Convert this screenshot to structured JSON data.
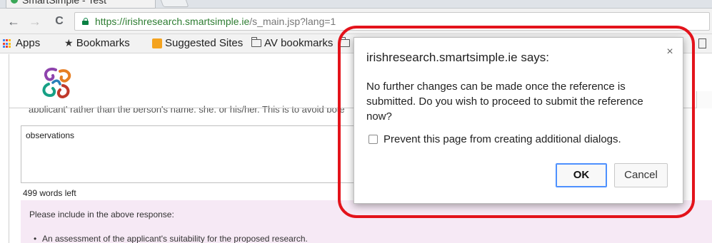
{
  "browser": {
    "tab_title": "SmartSimple - Test",
    "url_domain": "https://irishresearch.smartsimple.ie",
    "url_path": "/s_main.jsp?lang=1",
    "nav": {
      "back": "←",
      "forward": "→",
      "reload": "C"
    }
  },
  "bookmarks_bar": {
    "items": [
      {
        "label": "Apps",
        "icon": "apps-grid-icon"
      },
      {
        "label": "Bookmarks",
        "icon": "star-icon"
      },
      {
        "label": "Suggested Sites",
        "icon": "suggested-sites-icon"
      },
      {
        "label": "AV bookmarks",
        "icon": "folder-icon"
      }
    ]
  },
  "page": {
    "cut_off_text": "applicant' rather than the person's name, she, or his/her. This is to avoid pote",
    "textarea_value": "observations",
    "words_left": "499 words left",
    "instructions_intro": "Please include in the above response:",
    "instructions_bullets": [
      "An assessment of the applicant's suitability for the proposed research."
    ]
  },
  "dialog": {
    "title": "irishresearch.smartsimple.ie says:",
    "close_glyph": "×",
    "message": "No further changes can be made once the reference is submitted. Do you wish to proceed to submit the reference now?",
    "checkbox_label": "Prevent this page from creating additional dialogs.",
    "ok_label": "OK",
    "cancel_label": "Cancel"
  },
  "colors": {
    "annotation_red": "#e3131b",
    "url_green": "#2e7d32",
    "instructions_bg": "#f6e9f5",
    "ok_focus_blue": "#4d90fe"
  }
}
